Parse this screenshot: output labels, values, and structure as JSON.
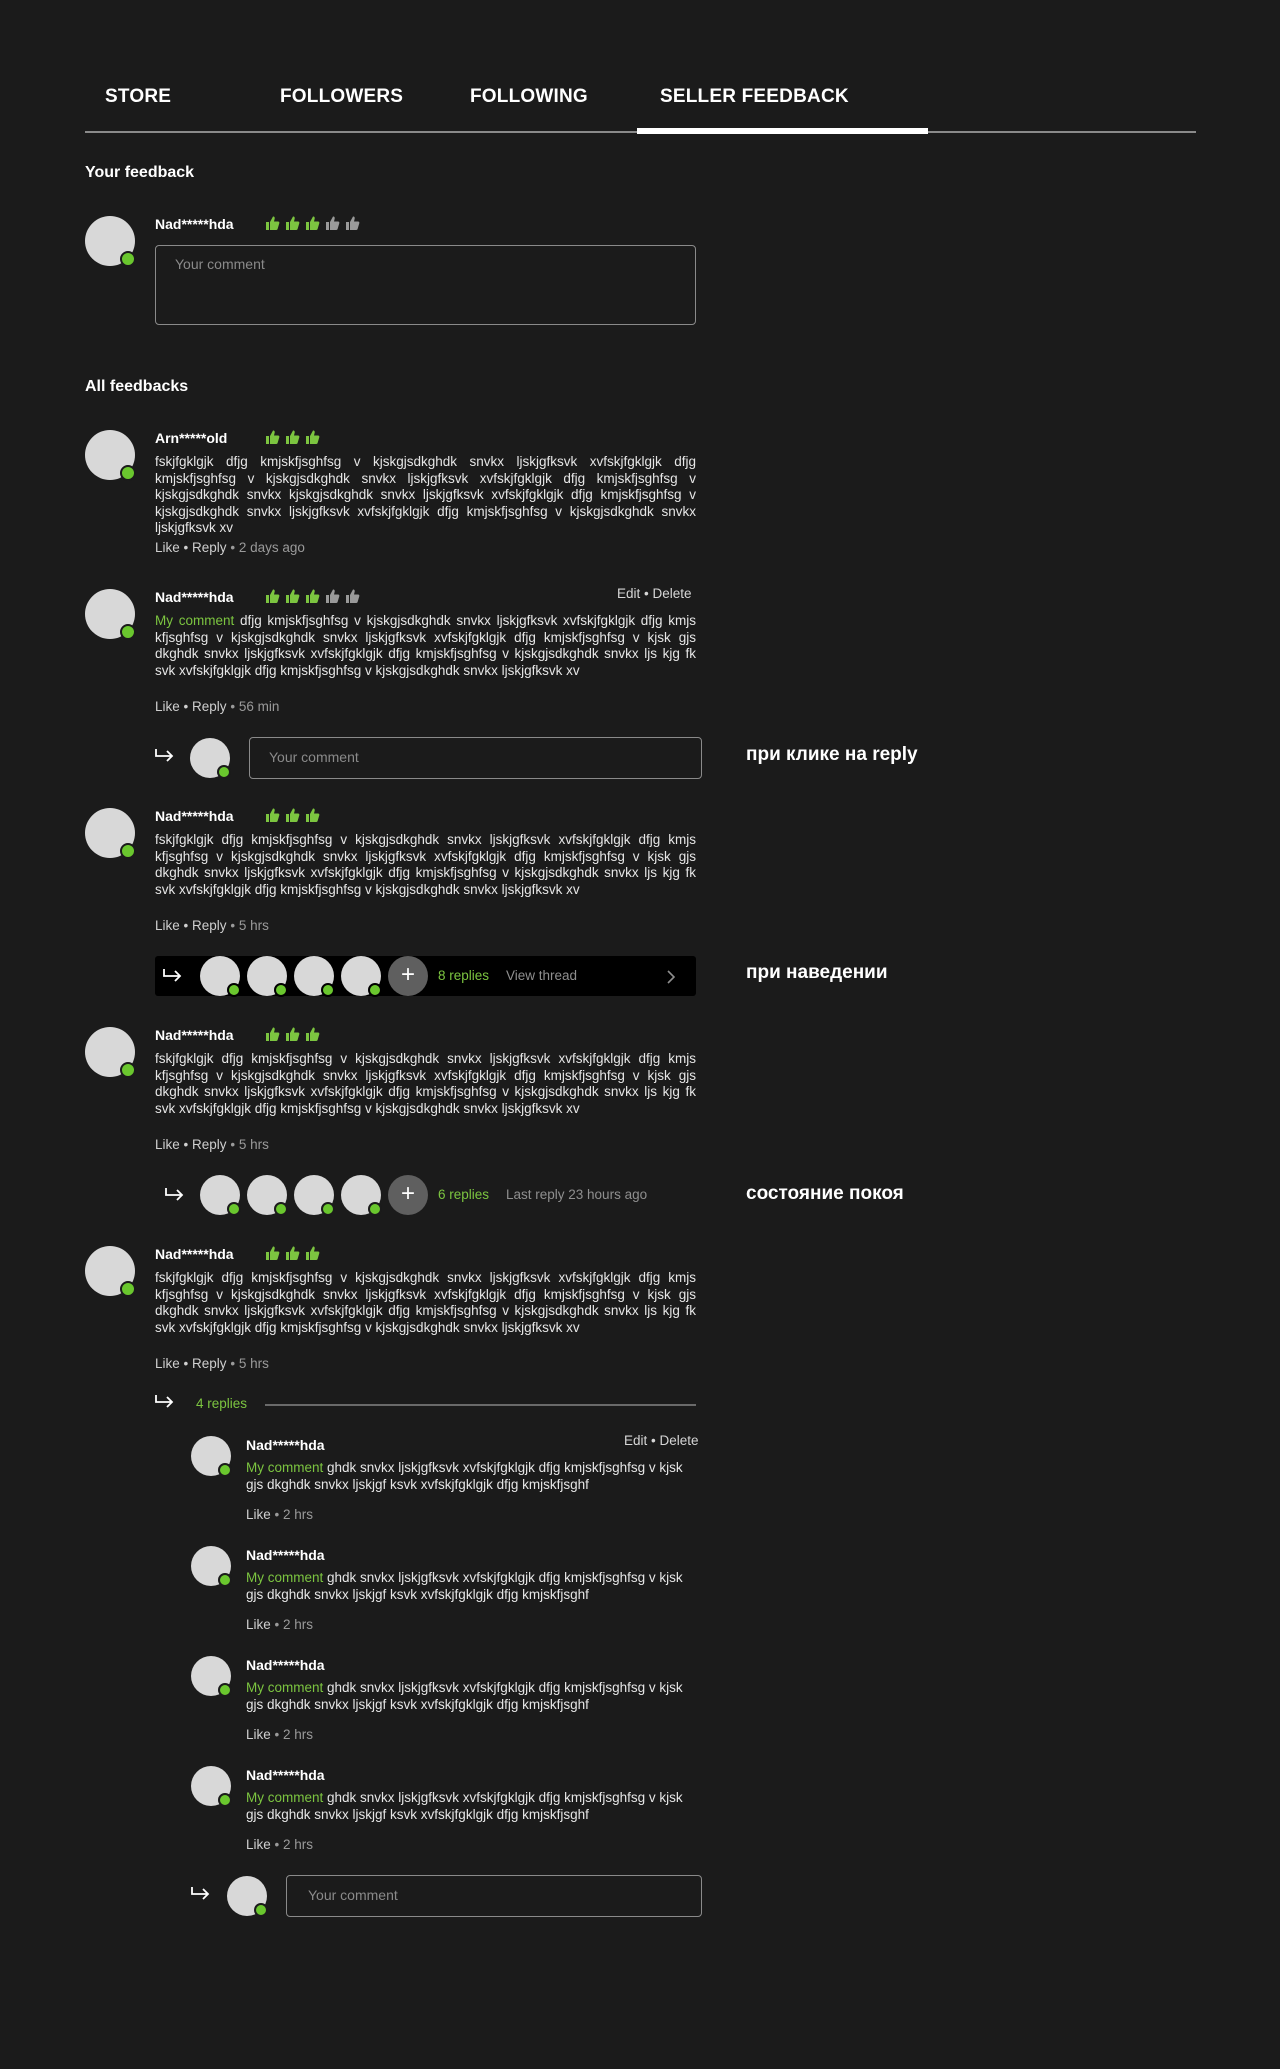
{
  "tabs": [
    "STORE",
    "FOLLOWERS",
    "FOLLOWING",
    "SELLER FEEDBACK"
  ],
  "your_feedback": {
    "title": "Your feedback",
    "author": "Nad*****hda",
    "rating": 3,
    "placeholder": "Your comment"
  },
  "all_feedbacks_title": "All feedbacks",
  "feedbacks": [
    {
      "author": "Arn*****old",
      "rating": 3,
      "text": "fskjfgklgjk dfjg kmjskfjsghfsg v kjskgjsdkghdk snvkx  ljskjgfksvk xvfskjfgklgjk dfjg kmjskfjsghfsg v kjskgjsdkghdk snvkx  ljskjgfksvk xvfskjfgklgjk dfjg kmjskfjsghfsg v kjskgjsdkghdk snvkx kjskgjsdkghdk snvkx  ljskjgfksvk xvfskjfgklgjk dfjg kmjskfjsghfsg v kjskgjsdkghdk snvkx ljskjgfksvk xvfskjfgklgjk dfjg kmjskfjsghfsg v kjskgjsdkghdk snvkx  ljskjgfksvk xv",
      "like": "Like",
      "reply": "Reply",
      "time": "2 days ago"
    },
    {
      "author": "Nad*****hda",
      "rating": 3,
      "mine_label": "My comment",
      "text": " dfjg kmjskfjsghfsg v kjskgjsdkghdk snvkx  ljskjgfksvk xvfskjfgklgjk dfjg kmjs kfjsghfsg v kjskgjsdkghdk snvkx  ljskjgfksvk xvfskjfgklgjk dfjg kmjskfjsghfsg v kjsk gjs dkghdk snvkx  ljskjgfksvk xvfskjfgklgjk dfjg kmjskfjsghfsg v kjskgjsdkghdk snvkx  ljs kjg fk svk xvfskjfgklgjk dfjg kmjskfjsghfsg v kjskgjsdkghdk snvkx  ljskjgfksvk xv",
      "like": "Like",
      "reply": "Reply",
      "time": "56 min",
      "edit": "Edit",
      "delete": "Delete",
      "reply_placeholder": "Your comment",
      "note": "при клике на reply"
    },
    {
      "author": "Nad*****hda",
      "rating": 3,
      "text": "fskjfgklgjk dfjg kmjskfjsghfsg v kjskgjsdkghdk snvkx  ljskjgfksvk xvfskjfgklgjk dfjg kmjs kfjsghfsg v kjskgjsdkghdk snvkx  ljskjgfksvk xvfskjfgklgjk dfjg kmjskfjsghfsg v kjsk gjs dkghdk snvkx  ljskjgfksvk xvfskjfgklgjk dfjg kmjskfjsghfsg v kjskgjsdkghdk snvkx  ljs kjg fk svk xvfskjfgklgjk dfjg kmjskfjsghfsg v kjskgjsdkghdk snvkx  ljskjgfksvk xv",
      "like": "Like",
      "reply": "Reply",
      "time": "5 hrs",
      "replies_count": "8 replies",
      "thread_action": "View thread",
      "note": "при наведении"
    },
    {
      "author": "Nad*****hda",
      "rating": 3,
      "text": "fskjfgklgjk dfjg kmjskfjsghfsg v kjskgjsdkghdk snvkx  ljskjgfksvk xvfskjfgklgjk dfjg kmjs kfjsghfsg v kjskgjsdkghdk snvkx  ljskjgfksvk xvfskjfgklgjk dfjg kmjskfjsghfsg v kjsk gjs dkghdk snvkx  ljskjgfksvk xvfskjfgklgjk dfjg kmjskfjsghfsg v kjskgjsdkghdk snvkx  ljs kjg fk svk xvfskjfgklgjk dfjg kmjskfjsghfsg v kjskgjsdkghdk snvkx  ljskjgfksvk xv",
      "like": "Like",
      "reply": "Reply",
      "time": "5 hrs",
      "replies_count": "6 replies",
      "last_reply": "Last reply 23 hours ago",
      "note": "состояние покоя"
    },
    {
      "author": "Nad*****hda",
      "rating": 3,
      "text": "fskjfgklgjk dfjg kmjskfjsghfsg v kjskgjsdkghdk snvkx  ljskjgfksvk xvfskjfgklgjk dfjg kmjs kfjsghfsg v kjskgjsdkghdk snvkx  ljskjgfksvk xvfskjfgklgjk dfjg kmjskfjsghfsg v kjsk gjs dkghdk snvkx  ljskjgfksvk xvfskjfgklgjk dfjg kmjskfjsghfsg v kjskgjsdkghdk snvkx  ljs kjg fk svk xvfskjfgklgjk dfjg kmjskfjsghfsg v kjskgjsdkghdk snvkx  ljskjgfksvk xv",
      "like": "Like",
      "reply": "Reply",
      "time": "5 hrs",
      "replies_count": "4 replies",
      "replies": [
        {
          "author": "Nad*****hda",
          "mine_label": "My comment",
          "text": "  ghdk snvkx  ljskjgfksvk xvfskjfgklgjk dfjg kmjskfjsghfsg v kjsk gjs dkghdk snvkx  ljskjgf ksvk xvfskjfgklgjk dfjg kmjskfjsghf",
          "like": "Like",
          "time": "2 hrs",
          "edit": "Edit",
          "delete": "Delete"
        },
        {
          "author": "Nad*****hda",
          "mine_label": "My comment",
          "text": "  ghdk snvkx  ljskjgfksvk xvfskjfgklgjk dfjg kmjskfjsghfsg v kjsk gjs dkghdk snvkx  ljskjgf ksvk xvfskjfgklgjk dfjg kmjskfjsghf",
          "like": "Like",
          "time": "2 hrs"
        },
        {
          "author": "Nad*****hda",
          "mine_label": "My comment",
          "text": "  ghdk snvkx  ljskjgfksvk xvfskjfgklgjk dfjg kmjskfjsghfsg v kjsk gjs dkghdk snvkx  ljskjgf ksvk xvfskjfgklgjk dfjg kmjskfjsghf",
          "like": "Like",
          "time": "2 hrs"
        },
        {
          "author": "Nad*****hda",
          "mine_label": "My comment",
          "text": "  ghdk snvkx  ljskjgfksvk xvfskjfgklgjk dfjg kmjskfjsghfsg v kjsk gjs dkghdk snvkx  ljskjgf ksvk xvfskjfgklgjk dfjg kmjskfjsghf",
          "like": "Like",
          "time": "2 hrs"
        }
      ],
      "reply_placeholder": "Your comment"
    }
  ],
  "dot": "•",
  "colors": {
    "accent": "#7cc540",
    "online": "#6ac72e",
    "background": "#1b1b1b",
    "thumb_off": "#9a9a9a"
  }
}
